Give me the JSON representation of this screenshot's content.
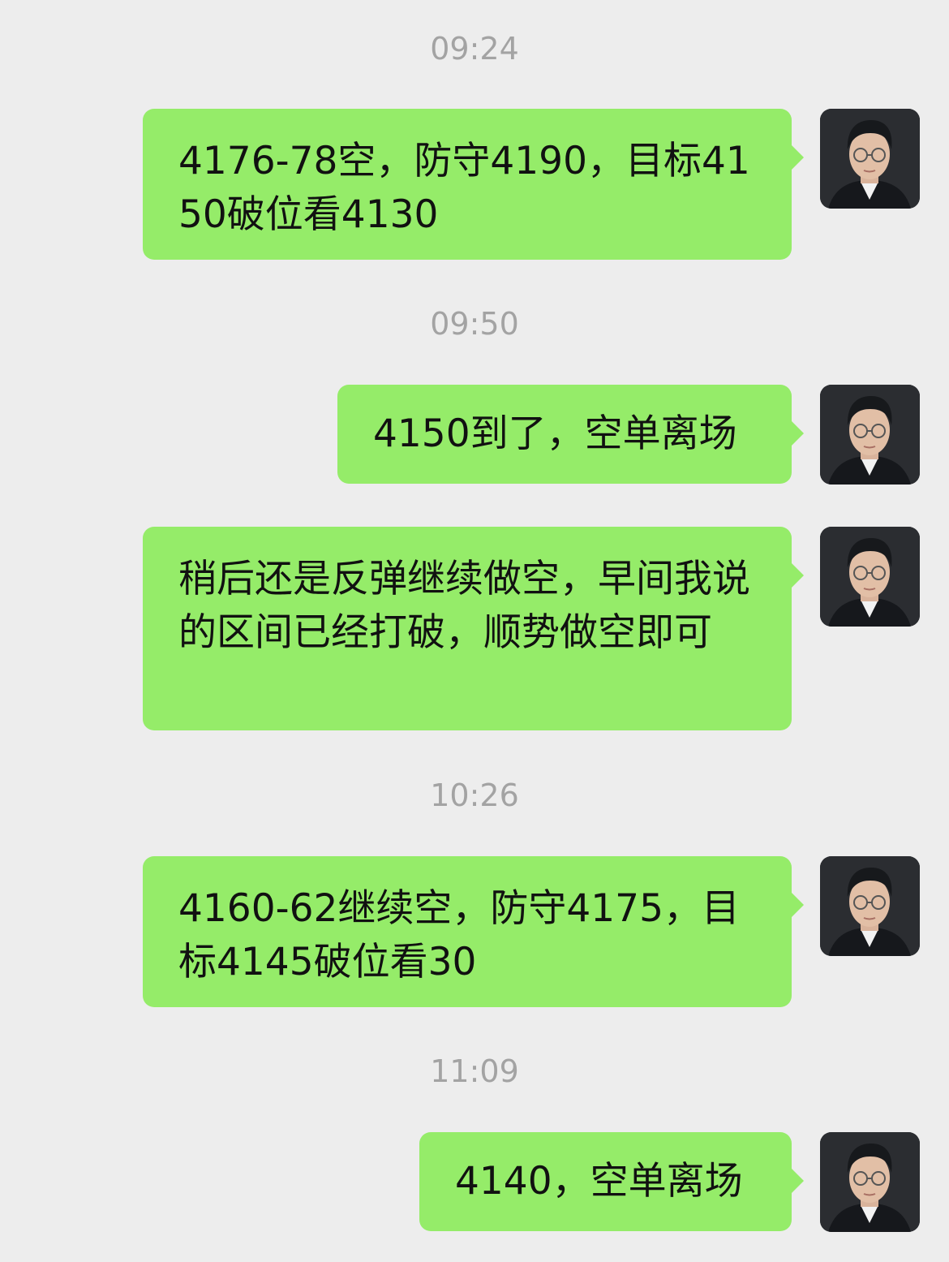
{
  "messages": [
    {
      "timestamp": "09:24",
      "text": "4176-78空，防守4190，目标4150破位看4130",
      "avatar_icon": "user-avatar-icon"
    },
    {
      "text": "4150到了，空单离场",
      "avatar_icon": "user-avatar-icon"
    },
    {
      "timestamp": "09:50",
      "text": "稍后还是反弹继续做空，早间我说的区间已经打破，顺势做空即可",
      "avatar_icon": "user-avatar-icon"
    },
    {
      "timestamp": "10:26",
      "text": "4160-62继续空，防守4175，目标4145破位看30",
      "avatar_icon": "user-avatar-icon"
    },
    {
      "timestamp": "11:09",
      "text": "4140，空单离场",
      "avatar_icon": "user-avatar-icon"
    }
  ],
  "colors": {
    "background": "#ededed",
    "bubble": "#95ec69",
    "timestamp": "#a3a3a3",
    "text": "#111111"
  }
}
